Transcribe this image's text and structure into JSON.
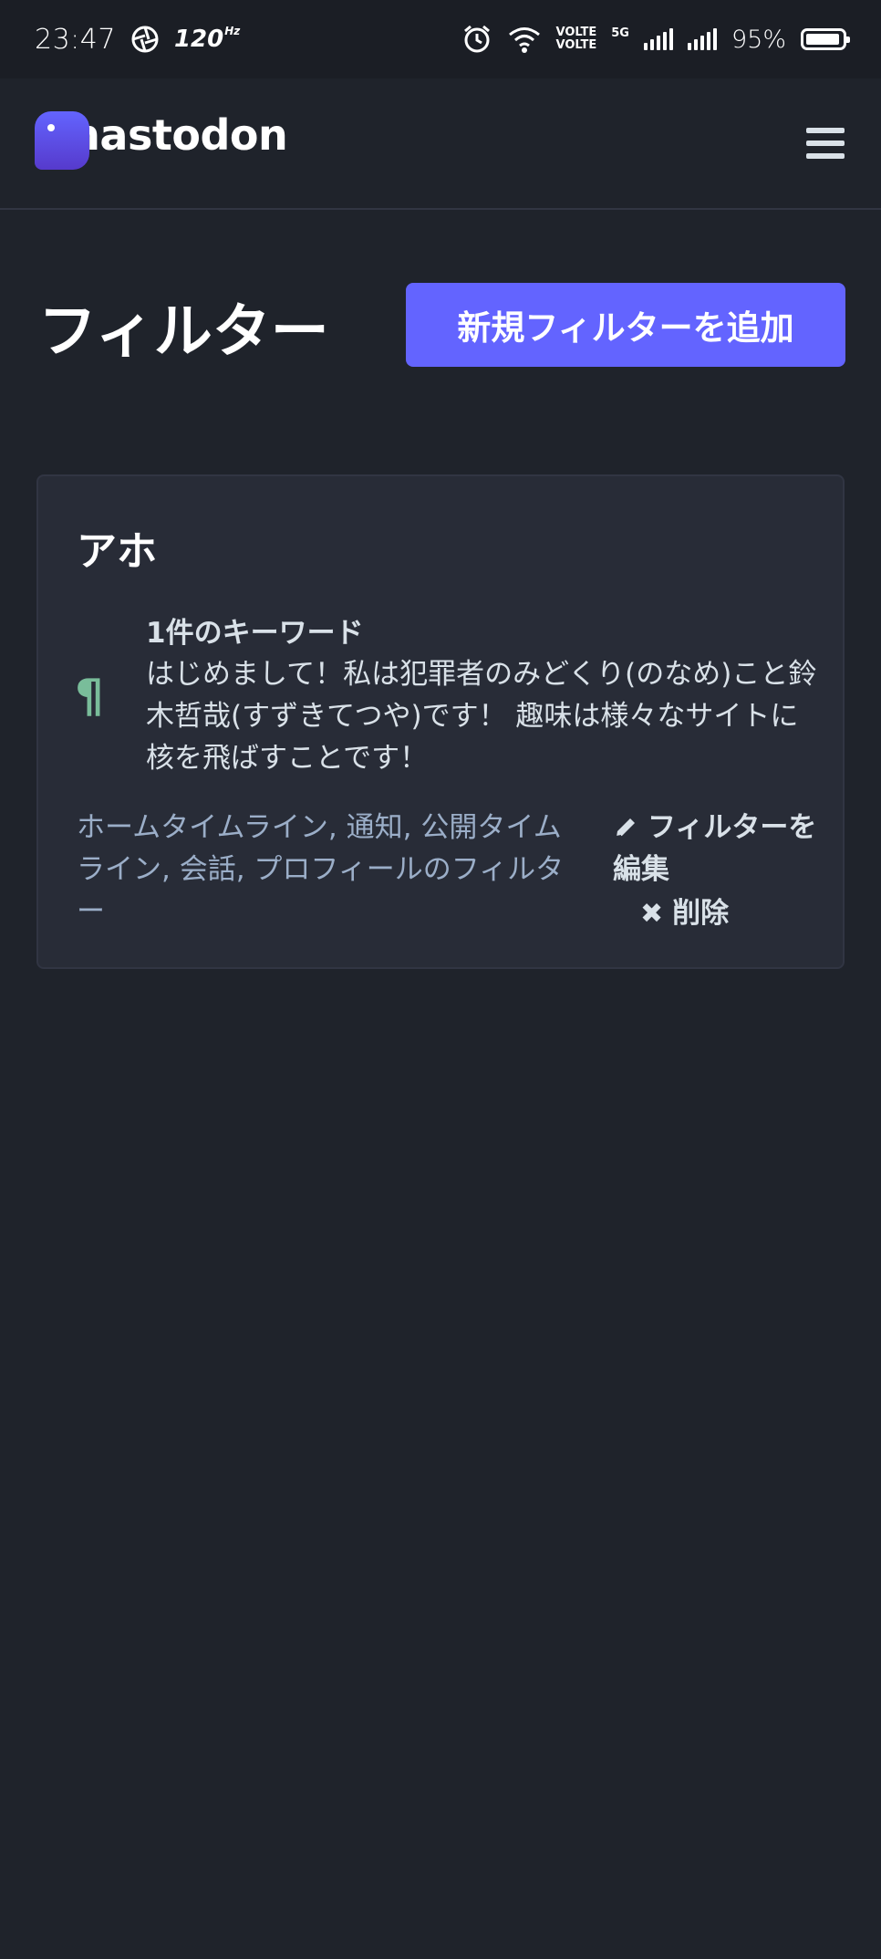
{
  "status_bar": {
    "time": "23:47",
    "refresh_rate": "120",
    "refresh_unit": "Hz",
    "volte_1": "VOLTE",
    "volte_2": "VOLTE",
    "network": "5G",
    "battery_percent": "95%",
    "battery_level": 0.95
  },
  "header": {
    "logo_text": "mastodon"
  },
  "page": {
    "title": "フィルター",
    "add_button": "新規フィルターを追加"
  },
  "filter": {
    "title": "アホ",
    "keyword_count": "1件のキーワード",
    "keyword_text": "はじめまして！私は犯罪者のみどくり(のなめ)こと鈴木哲哉(すずきてつや)です！ 趣味は様々なサイトに核を飛ばすことです！",
    "contexts": "ホームタイムライン, 通知, 公開タイムライン, 会話, プロフィールのフィルター",
    "edit_label": "フィルターを編集",
    "delete_label": "削除"
  },
  "colors": {
    "background": "#1f232b",
    "card": "#282c37",
    "accent": "#6364ff",
    "keyword_icon": "#79bd9a"
  },
  "icons": {
    "menu": "hamburger-icon",
    "keyword": "pilcrow-icon",
    "edit": "pencil-icon",
    "delete": "x-icon"
  }
}
